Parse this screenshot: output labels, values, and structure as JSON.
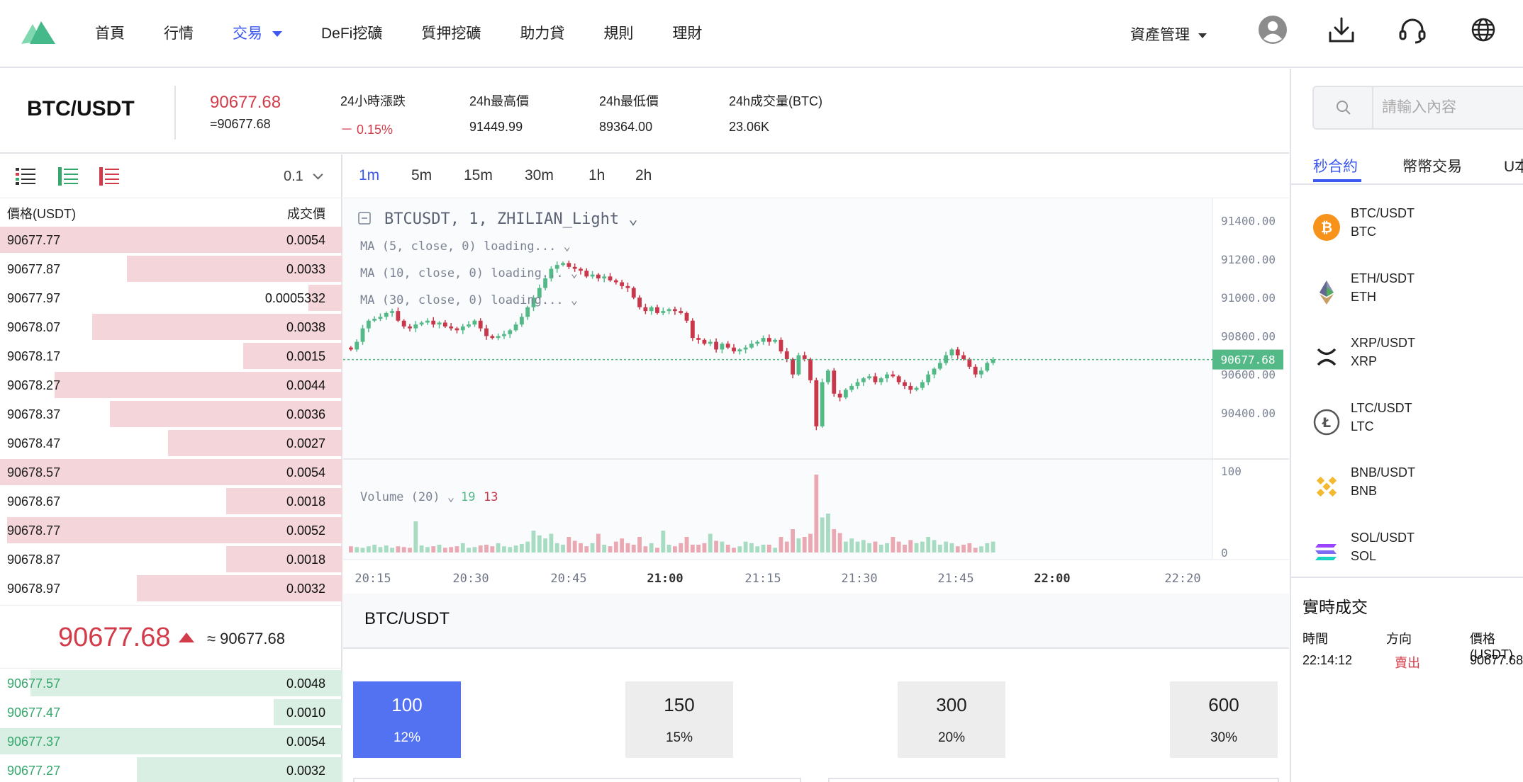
{
  "nav": {
    "items": [
      {
        "label": "首頁",
        "active": false
      },
      {
        "label": "行情",
        "active": false
      },
      {
        "label": "交易",
        "active": true,
        "dropdown": true
      },
      {
        "label": "DeFi挖礦",
        "active": false
      },
      {
        "label": "質押挖礦",
        "active": false
      },
      {
        "label": "助力貸",
        "active": false
      },
      {
        "label": "規則",
        "active": false
      },
      {
        "label": "理財",
        "active": false
      }
    ],
    "asset_menu": "資產管理",
    "icons": [
      "avatar-icon",
      "download-icon",
      "headset-icon",
      "globe-icon"
    ]
  },
  "ticker": {
    "pair": "BTC/USDT",
    "last_price": "90677.68",
    "last_price_approx": "=90677.68",
    "stats": [
      {
        "label": "24小時漲跌",
        "value": "－ 0.15%",
        "trend": "down"
      },
      {
        "label": "24h最高價",
        "value": "91449.99",
        "trend": "none"
      },
      {
        "label": "24h最低價",
        "value": "89364.00",
        "trend": "none"
      },
      {
        "label": "24h成交量(BTC)",
        "value": "23.06K",
        "trend": "none"
      }
    ]
  },
  "orderbook": {
    "precision": "0.1",
    "header_price": "價格(USDT)",
    "header_amount": "成交價",
    "asks": [
      {
        "price": "90677.77",
        "amount": "0.0054",
        "depth": 1.0
      },
      {
        "price": "90677.87",
        "amount": "0.0033",
        "depth": 0.63
      },
      {
        "price": "90677.97",
        "amount": "0.0005332",
        "depth": 0.1
      },
      {
        "price": "90678.07",
        "amount": "0.0038",
        "depth": 0.73
      },
      {
        "price": "90678.17",
        "amount": "0.0015",
        "depth": 0.29
      },
      {
        "price": "90678.27",
        "amount": "0.0044",
        "depth": 0.84
      },
      {
        "price": "90678.37",
        "amount": "0.0036",
        "depth": 0.68
      },
      {
        "price": "90678.47",
        "amount": "0.0027",
        "depth": 0.51
      },
      {
        "price": "90678.57",
        "amount": "0.0054",
        "depth": 1.0
      },
      {
        "price": "90678.67",
        "amount": "0.0018",
        "depth": 0.34
      },
      {
        "price": "90678.77",
        "amount": "0.0052",
        "depth": 0.98
      },
      {
        "price": "90678.87",
        "amount": "0.0018",
        "depth": 0.34
      },
      {
        "price": "90678.97",
        "amount": "0.0032",
        "depth": 0.6
      }
    ],
    "mid_price": "90677.68",
    "mid_approx": "≈ 90677.68",
    "bids": [
      {
        "price": "90677.57",
        "amount": "0.0048",
        "depth": 0.91
      },
      {
        "price": "90677.47",
        "amount": "0.0010",
        "depth": 0.2
      },
      {
        "price": "90677.37",
        "amount": "0.0054",
        "depth": 1.0
      },
      {
        "price": "90677.27",
        "amount": "0.0032",
        "depth": 0.6
      }
    ]
  },
  "chart": {
    "intervals": [
      "1m",
      "5m",
      "15m",
      "30m",
      "1h",
      "2h"
    ],
    "active_interval": "1m",
    "symbol_label": "BTCUSDT, 1, ZHILIAN_Light",
    "indicators": [
      "MA (5, close, 0) loading...",
      "MA (10, close, 0) loading...",
      "MA (30, close, 0) loading..."
    ],
    "volume_label": "Volume (20)",
    "volume_up": "19",
    "volume_down": "13",
    "current_price_tag": "90677.68",
    "colors": {
      "up": "#53b987",
      "down": "#c8374a",
      "accent": "#3b58f0"
    }
  },
  "chart_data": {
    "type": "candlestick",
    "title": "BTCUSDT, 1, ZHILIAN_Light",
    "y_ticks": [
      "91400.00",
      "91200.00",
      "91000.00",
      "90800.00",
      "90600.00",
      "90400.00"
    ],
    "y_range": [
      90300,
      91480
    ],
    "volume_ticks": [
      "100",
      "0"
    ],
    "x_ticks": [
      {
        "label": "20:15",
        "bold": false
      },
      {
        "label": "20:30",
        "bold": false
      },
      {
        "label": "20:45",
        "bold": false
      },
      {
        "label": "21:00",
        "bold": true
      },
      {
        "label": "21:15",
        "bold": false
      },
      {
        "label": "21:30",
        "bold": false
      },
      {
        "label": "21:45",
        "bold": false
      },
      {
        "label": "22:00",
        "bold": true
      },
      {
        "label": "22:20",
        "bold": false
      }
    ],
    "closes": [
      90730,
      90770,
      90840,
      90880,
      90890,
      90900,
      90920,
      90930,
      90880,
      90850,
      90840,
      90860,
      90870,
      90880,
      90860,
      90870,
      90850,
      90840,
      90830,
      90850,
      90860,
      90880,
      90840,
      90800,
      90790,
      90800,
      90810,
      90830,
      90860,
      90900,
      90950,
      91000,
      91050,
      91100,
      91150,
      91170,
      91180,
      91160,
      91150,
      91140,
      91110,
      91120,
      91100,
      91110,
      91090,
      91080,
      91060,
      91050,
      91000,
      90950,
      90930,
      90950,
      90920,
      90930,
      90940,
      90930,
      90920,
      90880,
      90790,
      90780,
      90760,
      90770,
      90730,
      90760,
      90740,
      90720,
      90730,
      90740,
      90760,
      90770,
      90790,
      90770,
      90780,
      90720,
      90680,
      90600,
      90700,
      90680,
      90570,
      90330,
      90560,
      90620,
      90500,
      90480,
      90520,
      90540,
      90560,
      90580,
      90590,
      90560,
      90580,
      90600,
      90590,
      90560,
      90540,
      90520,
      90530,
      90560,
      90600,
      90630,
      90660,
      90700,
      90730,
      90700,
      90680,
      90640,
      90600,
      90620,
      90660,
      90677.68
    ],
    "volumes": [
      8,
      7,
      6,
      8,
      10,
      7,
      9,
      6,
      8,
      7,
      6,
      40,
      9,
      7,
      8,
      10,
      6,
      7,
      8,
      12,
      6,
      7,
      9,
      10,
      8,
      12,
      8,
      7,
      9,
      11,
      14,
      28,
      22,
      18,
      24,
      12,
      10,
      20,
      15,
      12,
      8,
      12,
      24,
      10,
      8,
      14,
      18,
      12,
      10,
      20,
      8,
      12,
      6,
      28,
      10,
      8,
      12,
      20,
      10,
      10,
      12,
      24,
      15,
      14,
      10,
      6,
      8,
      14,
      12,
      8,
      10,
      10,
      6,
      20,
      14,
      30,
      18,
      20,
      24,
      100,
      45,
      50,
      30,
      25,
      14,
      18,
      14,
      16,
      12,
      14,
      10,
      12,
      20,
      14,
      10,
      16,
      12,
      14,
      20,
      16,
      10,
      14,
      12,
      8,
      10,
      12,
      6,
      8,
      12,
      14
    ]
  },
  "trade": {
    "title": "BTC/USDT",
    "durations": [
      {
        "seconds": "100",
        "pct": "12%",
        "active": true
      },
      {
        "seconds": "150",
        "pct": "15%",
        "active": false
      },
      {
        "seconds": "300",
        "pct": "20%",
        "active": false
      },
      {
        "seconds": "600",
        "pct": "30%",
        "active": false
      }
    ]
  },
  "markets": {
    "search_placeholder": "請輸入內容",
    "tabs": [
      {
        "label": "秒合約",
        "active": true
      },
      {
        "label": "幣幣交易",
        "active": false
      },
      {
        "label": "U本位",
        "active": false
      }
    ],
    "items": [
      {
        "pair": "BTC/USDT",
        "base": "BTC",
        "icon": "btc-icon"
      },
      {
        "pair": "ETH/USDT",
        "base": "ETH",
        "icon": "eth-icon"
      },
      {
        "pair": "XRP/USDT",
        "base": "XRP",
        "icon": "xrp-icon"
      },
      {
        "pair": "LTC/USDT",
        "base": "LTC",
        "icon": "ltc-icon"
      },
      {
        "pair": "BNB/USDT",
        "base": "BNB",
        "icon": "bnb-icon"
      },
      {
        "pair": "SOL/USDT",
        "base": "SOL",
        "icon": "sol-icon"
      }
    ]
  },
  "realtime": {
    "title": "實時成交",
    "headers": [
      "時間",
      "方向",
      "價格(USDT)"
    ],
    "rows": [
      {
        "time": "22:14:12",
        "side": "賣出",
        "price": "90677.68"
      }
    ]
  }
}
